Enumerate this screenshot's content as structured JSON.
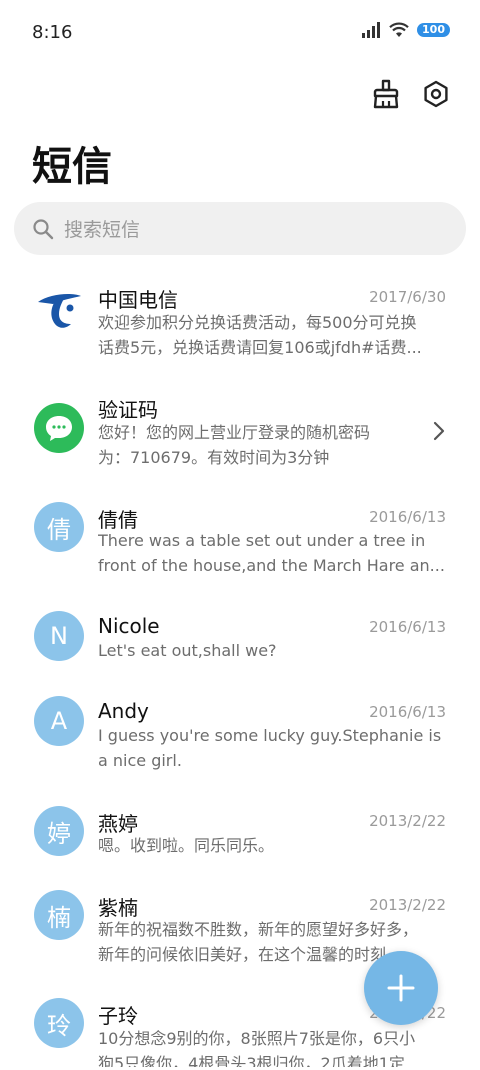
{
  "status": {
    "time": "8:16",
    "battery": "100",
    "icons": [
      "signal-icon",
      "wifi-icon",
      "battery-icon"
    ]
  },
  "toolbar": {
    "icons": [
      "broom-icon",
      "settings-icon"
    ]
  },
  "page": {
    "title": "短信"
  },
  "search": {
    "placeholder": "搜索短信"
  },
  "colors": {
    "accent": "#75b7e6",
    "avatar_bg": "#8cc4ea",
    "telecom_blue": "#1a56a8",
    "verify_green": "#2dbb5a"
  },
  "conversations": [
    {
      "name": "中国电信",
      "date": "2017/6/30",
      "avatar": "china-telecom-logo",
      "line1": "欢迎参加积分兑换话费活动，每500分可兑换",
      "line2": "话费5元，兑换话费请回复106或jfdh#话费..."
    },
    {
      "name": "验证码",
      "date": "",
      "avatar": "message-icon",
      "line1": "您好！您的网上营业厅登录的随机密码",
      "line2": "为：710679。有效时间为3分钟"
    },
    {
      "name": "倩倩",
      "date": "2016/6/13",
      "avatar": "倩",
      "line1": "There was a table set out under a tree in",
      "line2": "front of the house,and the March Hare an..."
    },
    {
      "name": "Nicole",
      "date": "2016/6/13",
      "avatar": "N",
      "line1": "Let's eat out,shall we?",
      "line2": ""
    },
    {
      "name": "Andy",
      "date": "2016/6/13",
      "avatar": "A",
      "line1": "I guess you're some lucky guy.Stephanie is",
      "line2": "a nice girl."
    },
    {
      "name": "燕婷",
      "date": "2013/2/22",
      "avatar": "婷",
      "line1": "嗯。收到啦。同乐同乐。",
      "line2": ""
    },
    {
      "name": "紫楠",
      "date": "2013/2/22",
      "avatar": "楠",
      "line1": "新年的祝福数不胜数，新年的愿望好多好多，",
      "line2": "新年的问候依旧美好，在这个温馨的时刻..."
    },
    {
      "name": "子玲",
      "date": "2013/2/22",
      "avatar": "玲",
      "line1": "10分想念9别的你，8张照片7张是你，6只小",
      "line2": "狗5只像你，4根骨头3根归你，2爪着地1定"
    }
  ]
}
